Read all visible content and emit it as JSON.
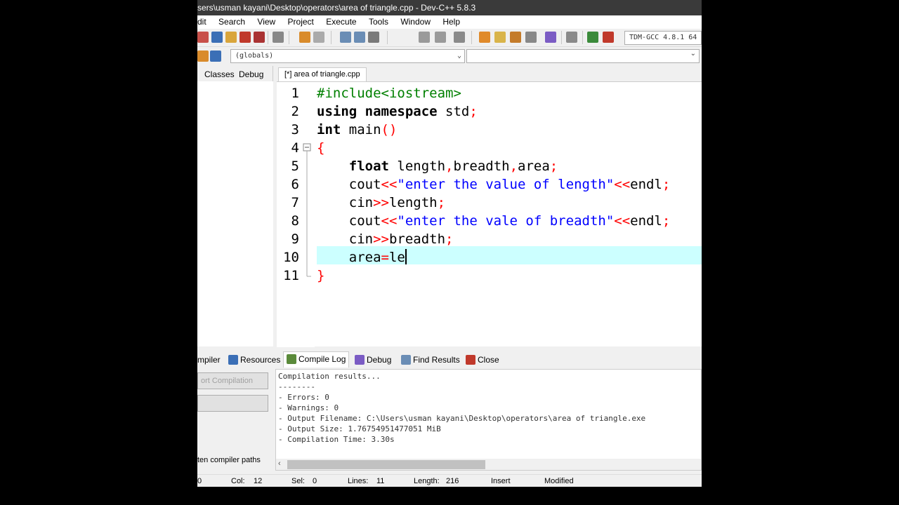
{
  "window": {
    "title": "sers\\usman kayani\\Desktop\\operators\\area of triangle.cpp - Dev-C++ 5.8.3"
  },
  "menu": [
    "dit",
    "Search",
    "View",
    "Project",
    "Execute",
    "Tools",
    "Window",
    "Help"
  ],
  "toolbar": {
    "compiler": "TDM-GCC 4.8.1 64"
  },
  "scope": {
    "globals": "(globals)"
  },
  "left_tabs": [
    "Classes",
    "Debug"
  ],
  "editor": {
    "tab_label": "[*] area of triangle.cpp",
    "line_numbers": [
      "1",
      "2",
      "3",
      "4",
      "5",
      "6",
      "7",
      "8",
      "9",
      "10",
      "11"
    ]
  },
  "bottom_tabs": {
    "compiler": "mpiler",
    "resources": "Resources",
    "compile_log": "Compile Log",
    "debug": "Debug",
    "find_results": "Find Results",
    "close": "Close"
  },
  "bottom_left": {
    "abort_label": "ort Compilation",
    "rewrite_label": "ten compiler paths"
  },
  "compile_log": [
    "Compilation results...",
    "--------",
    "- Errors: 0",
    "- Warnings: 0",
    "- Output Filename: C:\\Users\\usman kayani\\Desktop\\operators\\area of triangle.exe",
    "- Output Size: 1.76754951477051 MiB",
    "- Compilation Time: 3.30s"
  ],
  "status": {
    "line": "0",
    "col_label": "Col:",
    "col": "12",
    "sel_label": "Sel:",
    "sel": "0",
    "lines_label": "Lines:",
    "lines": "11",
    "length_label": "Length:",
    "length": "216",
    "mode": "Insert",
    "modified": "Modified"
  },
  "colors": {
    "active_line": "#ccffff",
    "string": "#0000ff",
    "preprocessor": "#008000",
    "symbol": "#ff0000"
  }
}
